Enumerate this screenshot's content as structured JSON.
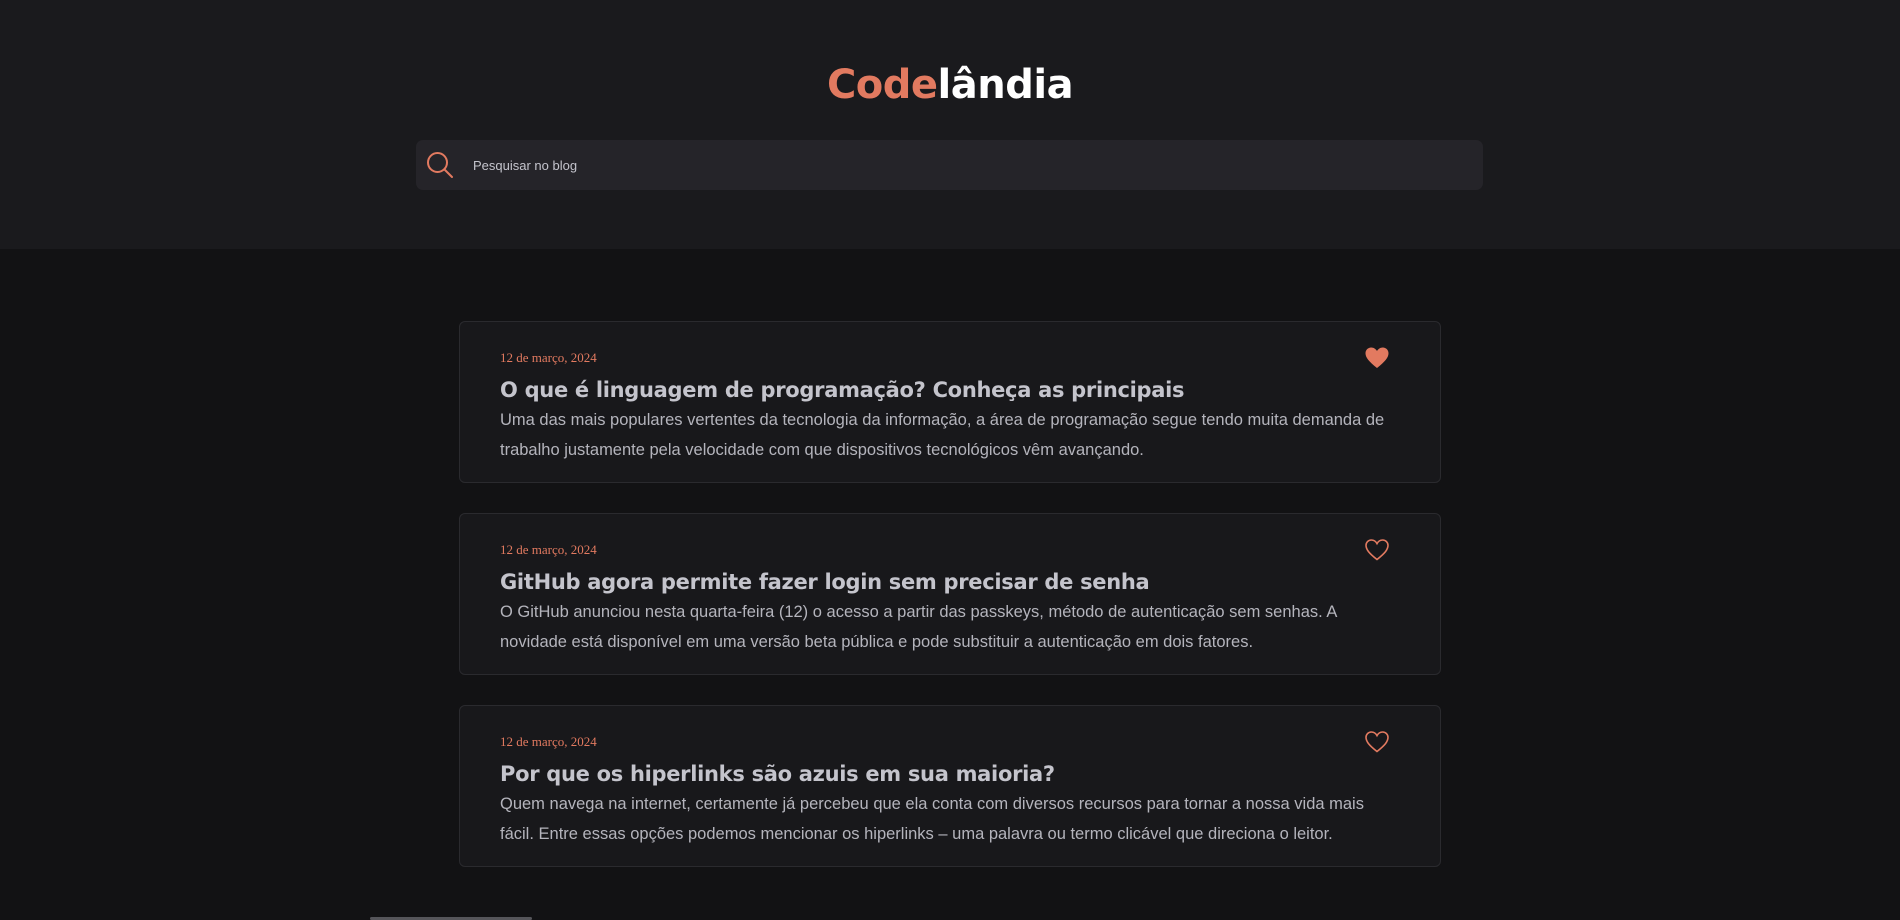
{
  "brand": {
    "accent_part": "Code",
    "rest_part": "lândia",
    "accent_color": "#e27a60"
  },
  "search": {
    "placeholder": "Pesquisar no blog",
    "value": "",
    "icon": "search-icon"
  },
  "posts": [
    {
      "date": "12 de março, 2024",
      "title": "O que é linguagem de programação? Conheça as principais",
      "excerpt": "Uma das mais populares vertentes da tecnologia da informação, a área de programação segue tendo muita demanda de trabalho justamente pela velocidade com que dispositivos tecnológicos vêm avançando.",
      "liked": true
    },
    {
      "date": "12 de março, 2024",
      "title": "GitHub agora permite fazer login sem precisar de senha",
      "excerpt": "O GitHub anunciou nesta quarta-feira (12) o acesso a partir das passkeys, método de autenticação sem senhas. A novidade está disponível em uma versão beta pública e pode substituir a autenticação em dois fatores.",
      "liked": false
    },
    {
      "date": "12 de março, 2024",
      "title": "Por que os hiperlinks são azuis em sua maioria?",
      "excerpt": "Quem navega na internet, certamente já percebeu que ela conta com diversos recursos para tornar a nossa vida mais fácil. Entre essas opções podemos mencionar os hiperlinks – uma palavra ou termo clicável que direciona o leitor.",
      "liked": false
    }
  ],
  "colors": {
    "header_bg": "#1a1a1d",
    "page_bg": "#121214",
    "card_bg": "#18181b",
    "accent": "#e27a60",
    "text": "#c4c4cc"
  }
}
